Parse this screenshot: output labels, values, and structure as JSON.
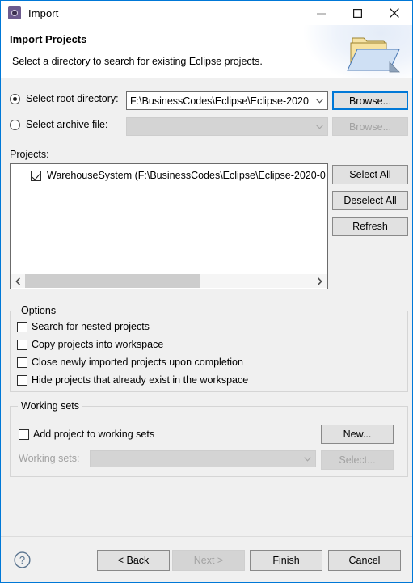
{
  "window": {
    "title": "Import",
    "icon": "eclipse-import-icon",
    "minimize_icon": "minimize-icon",
    "maximize_icon": "maximize-icon",
    "close_icon": "close-icon",
    "accent_color": "#0078d7",
    "body_color": "#f0f0f0"
  },
  "header": {
    "title": "Import Projects",
    "subtitle": "Select a directory to search for existing Eclipse projects.",
    "banner_icon": "folder-import-icon"
  },
  "source": {
    "root_radio_label": "Select root directory:",
    "root_radio_selected": true,
    "root_value": "F:\\BusinessCodes\\Eclipse\\Eclipse-2020",
    "root_browse_label": "Browse...",
    "root_browse_focused": true,
    "archive_radio_label": "Select archive file:",
    "archive_radio_selected": false,
    "archive_value": "",
    "archive_browse_label": "Browse...",
    "archive_browse_disabled": true,
    "dropdown_icon": "chevron-down-icon"
  },
  "projects": {
    "label": "Projects:",
    "items": [
      {
        "label": "WarehouseSystem (F:\\BusinessCodes\\Eclipse\\Eclipse-2020-0",
        "checked": true
      }
    ],
    "select_all_label": "Select All",
    "deselect_all_label": "Deselect All",
    "refresh_label": "Refresh",
    "scroll_left_icon": "chevron-left-icon",
    "scroll_right_icon": "chevron-right-icon",
    "scroll_thumb_percent": 61
  },
  "options": {
    "legend": "Options",
    "items": [
      {
        "label": "Search for nested projects",
        "checked": false
      },
      {
        "label": "Copy projects into workspace",
        "checked": false
      },
      {
        "label": "Close newly imported projects upon completion",
        "checked": false
      },
      {
        "label": "Hide projects that already exist in the workspace",
        "checked": false
      }
    ]
  },
  "working_sets": {
    "legend": "Working sets",
    "add_label": "Add project to working sets",
    "add_checked": false,
    "new_label": "New...",
    "sets_label": "Working sets:",
    "sets_value": "",
    "sets_disabled": true,
    "select_label": "Select...",
    "select_disabled": true,
    "dropdown_icon": "chevron-down-icon"
  },
  "footer": {
    "help_icon": "help-circle-icon",
    "back_label": "< Back",
    "next_label": "Next >",
    "next_disabled": true,
    "finish_label": "Finish",
    "cancel_label": "Cancel"
  }
}
